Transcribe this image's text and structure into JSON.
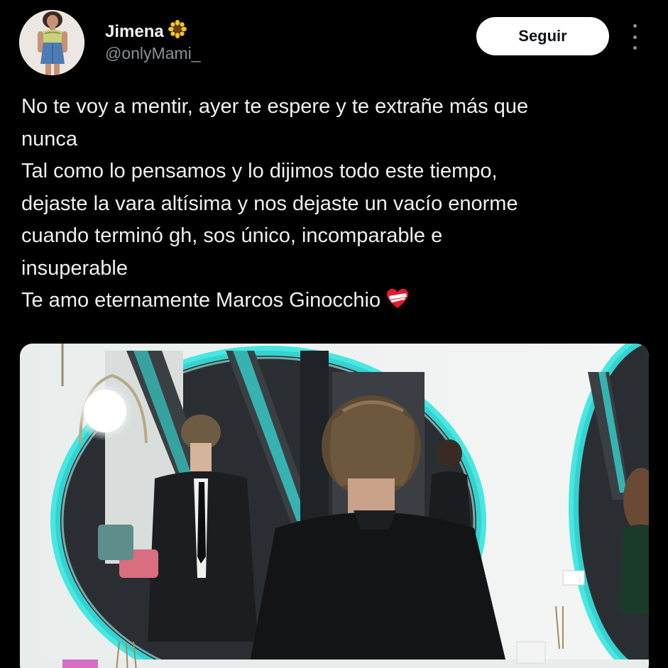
{
  "author": {
    "display_name": "Jimena",
    "name_emoji": "🌻",
    "handle": "@onlyMami_",
    "avatar_icon": "avatar-photo"
  },
  "actions": {
    "follow_label": "Seguir",
    "more_icon": "more-vertical-icon"
  },
  "tweet": {
    "lines": [
      "No te voy a mentir, ayer te espere y te extrañe más que",
      "nunca",
      "Tal como lo pensamos y lo dijimos todo este tiempo,",
      "dejaste la vara altísima y nos dejaste un vacío enorme",
      "cuando terminó gh, sos único, incomparable e",
      "insuperable",
      "Te amo eternamente Marcos Ginocchio"
    ],
    "trailing_emoji": "❤️‍🩹"
  },
  "media": {
    "type": "photo"
  },
  "colors": {
    "background": "#000000",
    "text": "#e7e9ea",
    "secondary_text": "#8b9096",
    "button_bg": "#ffffff",
    "accent_glow": "#35e6e0"
  }
}
